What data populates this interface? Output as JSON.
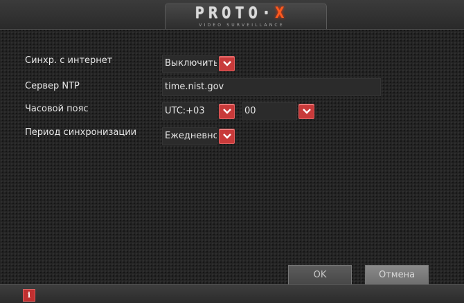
{
  "header": {
    "logo_main": "PROTO",
    "logo_sep": "·",
    "logo_x": "X",
    "logo_sub": "VIDEO SURVEILLANCE"
  },
  "form": {
    "sync_label": "Синхр. с интернет",
    "sync_value": "Выключить",
    "ntp_label": "Сервер NTP",
    "ntp_value": "time.nist.gov",
    "tz_label": "Часовой пояс",
    "tz_hours": "UTC:+03",
    "tz_minutes": "00",
    "period_label": "Период синхронизации",
    "period_value": "Ежедневно"
  },
  "buttons": {
    "ok": "OK",
    "cancel": "Отмена"
  },
  "status": {
    "info_icon": "i"
  },
  "colors": {
    "accent": "#c83a3a",
    "logo_x": "#ff5a1e"
  }
}
